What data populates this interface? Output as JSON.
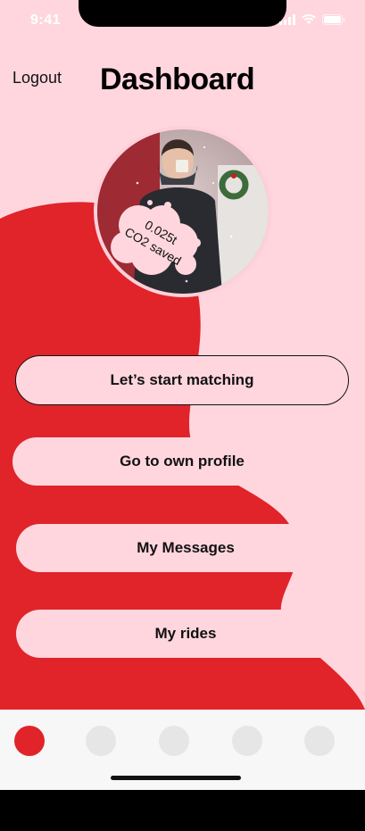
{
  "status_bar": {
    "time": "9:41"
  },
  "header": {
    "logout_label": "Logout",
    "title": "Dashboard"
  },
  "profile": {
    "co2_amount": "0.025t",
    "co2_label": "CO2 saved"
  },
  "menu": {
    "start_matching": "Let’s start matching",
    "own_profile": "Go to own profile",
    "messages": "My Messages",
    "rides": "My rides"
  },
  "bottom_nav": {
    "active_index": 0,
    "count": 5
  },
  "colors": {
    "background": "#ffd6de",
    "accent_red": "#e0242a",
    "nav_inactive": "#e6e6e6",
    "nav_bg": "#f7f7f7"
  }
}
